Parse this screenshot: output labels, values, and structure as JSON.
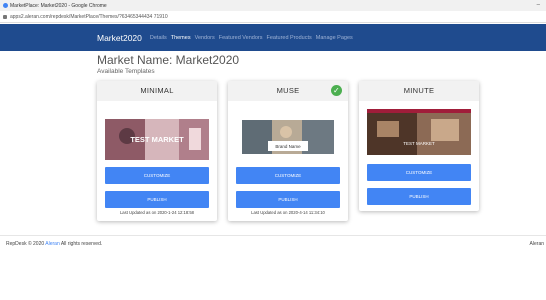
{
  "window": {
    "title": "MarketPlace: Market2020 - Google Chrome",
    "minimize_glyph": "–"
  },
  "address": {
    "url": "apps2.aleran.com/repdesk/MarketPlace/Themes/?63465344434 71910"
  },
  "nav": {
    "brand": "Market2020",
    "links": [
      "Details",
      "Themes",
      "Vendors",
      "Featured Vendors",
      "Featured Products",
      "Manage Pages"
    ],
    "active": "Themes"
  },
  "page": {
    "title": "Market Name: Market2020",
    "subtitle": "Available Templates"
  },
  "templates": [
    {
      "name": "MINIMAL",
      "thumb_caption": "TEST MARKET",
      "customize_label": "CUSTOMIZE",
      "publish_label": "PUBLISH",
      "updated": "Last Updated as on 2020-1-24 12:18:58",
      "selected": false
    },
    {
      "name": "MUSE",
      "thumb_caption": "Brand Name",
      "customize_label": "CUSTOMIZE",
      "publish_label": "PUBLISH",
      "updated": "Last Updated as on 2020-4-14 11:34:10",
      "selected": true
    },
    {
      "name": "MINUTE",
      "thumb_caption": "TEST MARKET",
      "customize_label": "CUSTOMIZE",
      "publish_label": "PUBLISH",
      "updated": "",
      "selected": false
    }
  ],
  "footer": {
    "prefix": "RepDesk © 2020 ",
    "company_link": "Aleran",
    "suffix": " All rights reserved.",
    "right": "Aleran"
  },
  "colors": {
    "navbar": "#1f4b8e",
    "button": "#4285f4",
    "check": "#4caf50"
  },
  "icons": {
    "selected_badge": "check-circle-icon"
  }
}
